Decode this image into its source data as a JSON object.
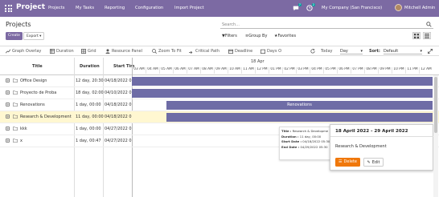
{
  "navbar": {
    "brand": "Project",
    "menu": [
      "Projects",
      "My Tasks",
      "Reporting",
      "Configuration",
      "Import Project"
    ],
    "chat_count": "7",
    "activity_count": "2",
    "company": "My Company (San Francisco)",
    "user": "Mitchell Admin",
    "color": "#7c6aa3"
  },
  "control": {
    "title": "Projects",
    "create_label": "Create",
    "export_label": "Export",
    "search_placeholder": "Search...",
    "filters_label": "Filters",
    "groupby_label": "Group By",
    "favorites_label": "Favorites"
  },
  "toolbar": {
    "graph_overlay": "Graph Overlay",
    "duration": "Duration",
    "grid": "Grid",
    "resource_panel": "Resource Panel",
    "zoom_to_fit": "Zoom To Fit",
    "critical_path": "Critical Path",
    "deadline": "Deadline",
    "days_off": "Days O",
    "today": "Today",
    "scale_value": "Day",
    "sort_label": "Sort:",
    "sort_value": "Default"
  },
  "grid": {
    "columns": {
      "title": "Title",
      "duration": "Duration",
      "start": "Start Tim"
    },
    "date_header": "18 Apr",
    "hours": [
      "03 AM",
      "04 AM",
      "05 AM",
      "06 AM",
      "07 AM",
      "08 AM",
      "09 AM",
      "10 AM",
      "11 AM",
      "12 PM",
      "01 PM",
      "02 PM",
      "03 PM",
      "04 PM",
      "05 PM",
      "06 PM",
      "07 PM",
      "08 PM",
      "09 PM",
      "10 PM",
      "11 PM",
      "12 AM"
    ],
    "rows": [
      {
        "title": "Office Design",
        "duration": "12 day, 20:30",
        "start": "04/18/2022 03:",
        "bar_label": ""
      },
      {
        "title": "Proyecto de Proba",
        "duration": "18 day, 02:00",
        "start": "04/10/2022 03:",
        "bar_label": ""
      },
      {
        "title": "Renovations",
        "duration": "1 day, 00:00",
        "start": "04/18/2022 05:",
        "bar_label": "Renovations"
      },
      {
        "title": "Research & Development",
        "duration": "11 day, 00:00",
        "start": "04/18/2022 05:",
        "bar_label": ""
      },
      {
        "title": "kkk",
        "duration": "1 day, 00:00",
        "start": "04/27/2022 03:",
        "bar_label": ""
      },
      {
        "title": "x",
        "duration": "1 day, 00:47",
        "start": "04/27/2022 03:",
        "bar_label": ""
      }
    ]
  },
  "tooltip": {
    "title_label": "Title :",
    "title_value": "Research & Developme",
    "duration_label": "Duration :",
    "duration_value": "11 day, 00:00",
    "start_label": "Start Date :",
    "start_value": "04/18/2022 05:30",
    "end_label": "End Date :",
    "end_value": "04/29/2022 05:30"
  },
  "popover": {
    "title": "18 April 2022 - 29 April 2022",
    "body": "Research & Development",
    "delete_label": "Delete",
    "edit_label": "Edit",
    "delete_color": "#f0780b"
  }
}
